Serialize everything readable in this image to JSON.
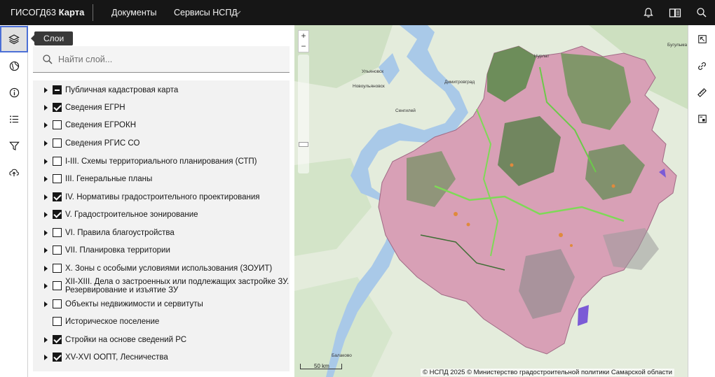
{
  "header": {
    "brand_prefix": "ГИСОГД63",
    "brand_app": "Карта",
    "nav": [
      {
        "label": "Документы"
      },
      {
        "label": "Сервисы НСПД"
      }
    ],
    "icons": [
      "bell-icon",
      "book-icon",
      "search-icon"
    ]
  },
  "left_rail": {
    "items": [
      {
        "icon": "layers-icon",
        "active": true
      },
      {
        "icon": "globe-icon"
      },
      {
        "icon": "info-icon"
      },
      {
        "icon": "list-icon"
      },
      {
        "icon": "filter-icon"
      },
      {
        "icon": "upload-icon"
      }
    ],
    "tooltip": "Слои"
  },
  "layers_panel": {
    "search_placeholder": "Найти слой...",
    "layers": [
      {
        "label": "Публичная кадастровая карта",
        "state": "indeterminate",
        "expandable": true
      },
      {
        "label": "Сведения ЕГРН",
        "state": "checked",
        "expandable": true
      },
      {
        "label": "Сведения ЕГРОКН",
        "state": "unchecked",
        "expandable": true
      },
      {
        "label": "Сведения РГИС СО",
        "state": "unchecked",
        "expandable": true
      },
      {
        "label": "I-III. Схемы территориального планирования (СТП)",
        "state": "unchecked",
        "expandable": true
      },
      {
        "label": "III. Генеральные планы",
        "state": "unchecked",
        "expandable": true
      },
      {
        "label": "IV. Нормативы градостроительного проектирования",
        "state": "checked",
        "expandable": true
      },
      {
        "label": "V. Градостроительное зонирование",
        "state": "checked",
        "expandable": true
      },
      {
        "label": "VI. Правила благоустройства",
        "state": "unchecked",
        "expandable": true
      },
      {
        "label": "VII. Планировка территории",
        "state": "unchecked",
        "expandable": true
      },
      {
        "label": "X. Зоны с особыми условиями использования (ЗОУИТ)",
        "state": "unchecked",
        "expandable": true
      },
      {
        "label": "XII-XIII. Дела о застроенных или подлежащих застройке ЗУ. Резервирование и изъятие ЗУ",
        "state": "unchecked",
        "expandable": true
      },
      {
        "label": "Объекты недвижимости и сервитуты",
        "state": "unchecked",
        "expandable": true
      },
      {
        "label": "Историческое поселение",
        "state": "unchecked",
        "expandable": false
      },
      {
        "label": "Стройки на основе сведений РС",
        "state": "checked",
        "expandable": true
      },
      {
        "label": "XV-XVI ООПТ, Лесничества",
        "state": "checked",
        "expandable": true
      }
    ]
  },
  "map": {
    "zoom_in": "+",
    "zoom_out": "−",
    "scale_label": "50 km",
    "attribution": "© НСПД 2025 © Министерство градостроительной политики Самарской области",
    "place_labels": [
      "Ульяновск",
      "Новоульяновск",
      "Димитровград",
      "Сенгилей",
      "Балаково",
      "Бугульма",
      "Нурлат"
    ]
  },
  "right_rail": {
    "items": [
      "extent-icon",
      "link-icon",
      "ruler-icon",
      "print-icon"
    ]
  },
  "colors": {
    "topbar": "#161616",
    "panel_bg": "#f2f2f2",
    "active_border": "#4b6fd6",
    "parcel_pink": "#d8a0b6",
    "forest_green": "#5a8a4a",
    "water": "#a9c9e8"
  }
}
